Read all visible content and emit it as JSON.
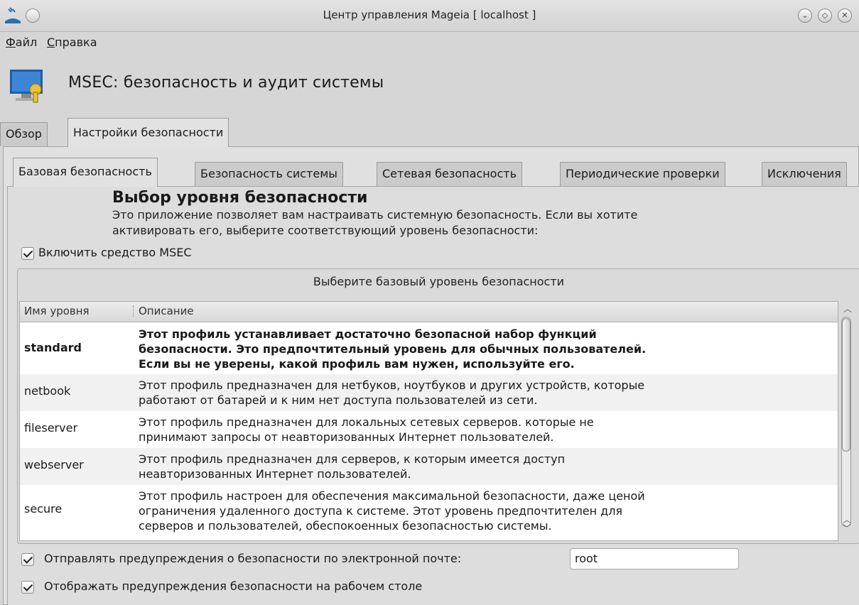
{
  "window": {
    "title": "Центр управления Mageia  [ localhost ]",
    "buttons": {
      "minimize": "⌄",
      "restore": "◇",
      "close": "✕"
    }
  },
  "menu": [
    {
      "underline": "Ф",
      "rest": "айл"
    },
    {
      "underline": "С",
      "rest": "правка"
    }
  ],
  "header": {
    "title": "MSEC: безопасность и аудит системы",
    "icon": "msec-shield-monitor-icon"
  },
  "outer_tabs": [
    {
      "label": "Обзор",
      "active": false
    },
    {
      "label": "Настройки безопасности",
      "active": true
    }
  ],
  "inner_tabs": [
    {
      "label": "Базовая безопасность",
      "active": true
    },
    {
      "label": "Безопасность системы",
      "active": false
    },
    {
      "label": "Сетевая безопасность",
      "active": false
    },
    {
      "label": "Периодические проверки",
      "active": false
    },
    {
      "label": "Исключения",
      "active": false
    }
  ],
  "section": {
    "title": "Выбор уровня безопасности",
    "description_line1": "Это приложение позволяет вам настраивать системную безопасность. Если вы хотите",
    "description_line2": "активировать его, выберите соответствующий уровень безопасности:"
  },
  "enable_msec": {
    "label": "Включить средство MSEC",
    "checked": true
  },
  "group": {
    "title": "Выберите базовый уровень безопасности"
  },
  "table": {
    "columns": [
      "Имя уровня",
      "Описание"
    ],
    "rows": [
      {
        "name": "standard",
        "bold": true,
        "lines": [
          "Этот профиль устанавливает достаточно безопасной набор функций",
          "безопасности. Это предпочтительный уровень для обычных пользователей.",
          "Если вы не уверены, какой профиль вам нужен, используйте его."
        ]
      },
      {
        "name": "netbook",
        "bold": false,
        "lines": [
          "Этот профиль предназначен для нетбуков, ноутбуков и других устройств, которые",
          "работают от батарей и к ним нет доступа пользователей из сети."
        ]
      },
      {
        "name": "fileserver",
        "bold": false,
        "lines": [
          "Этот профиль предназначен для локальных сетевых серверов. которые не",
          "принимают запросы от неавторизованных Интернет пользователей."
        ]
      },
      {
        "name": "webserver",
        "bold": false,
        "lines": [
          "Этот профиль предназначен для серверов, к которым имеется доступ",
          "неавторизованных Интернет пользователей."
        ]
      },
      {
        "name": "secure",
        "bold": false,
        "lines": [
          "Этот профиль настроен для обеспечения максимальной безопасности, даже ценой",
          "ограничения удаленного доступа к системе. Этот уровень предпочтителен для",
          "серверов и пользователей, обеспокоенных безопасностью системы."
        ]
      }
    ]
  },
  "email_alerts": {
    "label": "Отправлять предупреждения о безопасности по электронной почте:",
    "checked": true,
    "value": "root"
  },
  "desktop_alerts": {
    "label": "Отображать предупреждения безопасности на рабочем столе",
    "checked": true
  },
  "colors": {
    "window_bg": "#d6d6d6",
    "table_bg": "#ffffff",
    "alt_row": "#f1f1f1"
  }
}
